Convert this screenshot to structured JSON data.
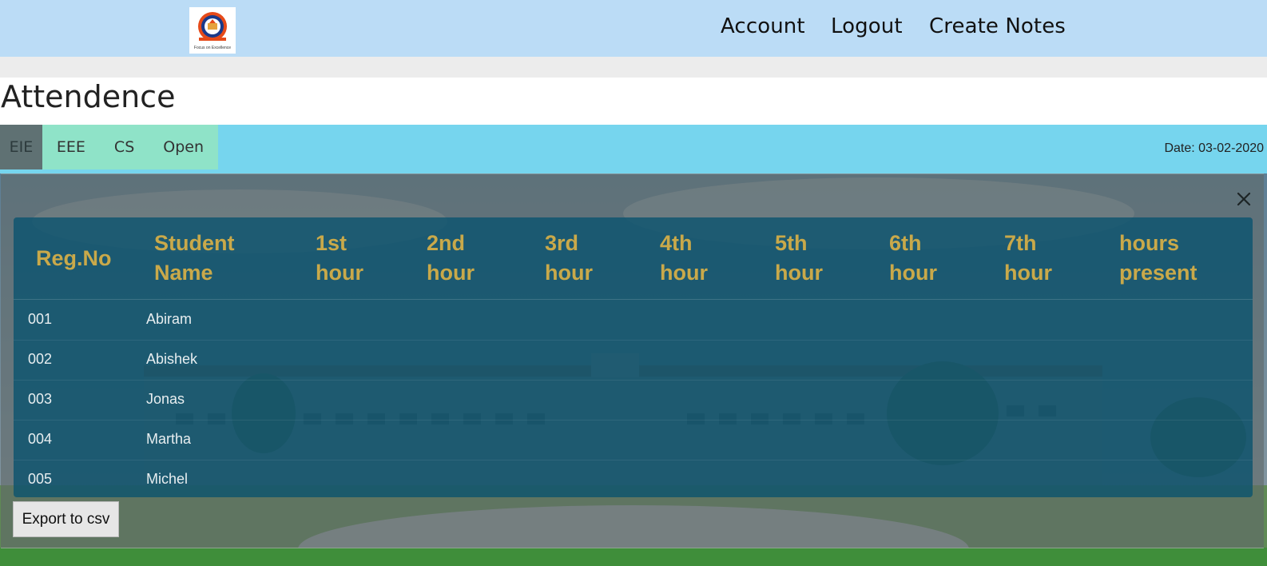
{
  "nav": {
    "logo_caption": "Focus on Excellence",
    "account": "Account",
    "logout": "Logout",
    "create_notes": "Create Notes"
  },
  "page": {
    "title": "Attendence"
  },
  "tabs": [
    {
      "label": "EIE",
      "active": true
    },
    {
      "label": "EEE",
      "active": false
    },
    {
      "label": "CS",
      "active": false
    },
    {
      "label": "Open",
      "active": false
    }
  ],
  "date_label": "Date: 03-02-2020",
  "table": {
    "headers": [
      [
        "Reg.No"
      ],
      [
        "Student",
        "Name"
      ],
      [
        "1st",
        "hour"
      ],
      [
        "2nd",
        "hour"
      ],
      [
        "3rd",
        "hour"
      ],
      [
        "4th",
        "hour"
      ],
      [
        "5th",
        "hour"
      ],
      [
        "6th",
        "hour"
      ],
      [
        "7th",
        "hour"
      ],
      [
        "hours",
        "present"
      ]
    ],
    "rows": [
      {
        "reg_no": "001",
        "name": "Abiram"
      },
      {
        "reg_no": "002",
        "name": "Abishek"
      },
      {
        "reg_no": "003",
        "name": "Jonas"
      },
      {
        "reg_no": "004",
        "name": "Martha"
      },
      {
        "reg_no": "005",
        "name": "Michel"
      }
    ]
  },
  "export_label": "Export to csv",
  "colors": {
    "nav_bg": "#bbdcf6",
    "tabs_row_bg": "#76d5ee",
    "tabs_bg": "#8fe3c8",
    "active_tab_bg": "#5f7173",
    "table_bg": "#08526e",
    "header_text": "#c9a94a"
  },
  "icons": {
    "close": "close-icon",
    "logo": "college-logo"
  }
}
